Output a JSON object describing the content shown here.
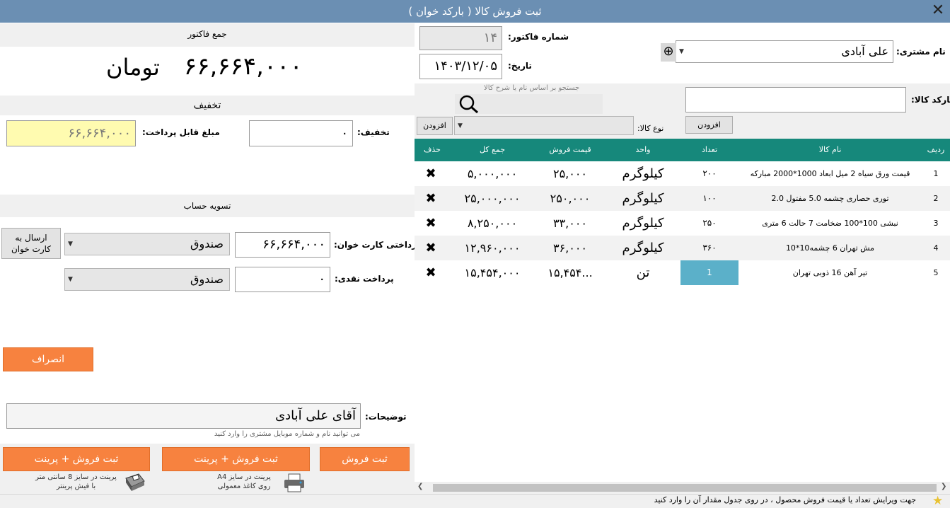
{
  "window": {
    "title": "ثبت فروش کالا ( بارکد خوان )",
    "close": "✕"
  },
  "invoice": {
    "total_heading": "جمع فاکتور",
    "total_amount": "۶۶,۶۶۴,۰۰۰",
    "currency": "تومان",
    "discount_heading": "تخفیف",
    "discount_label": "تخفیف:",
    "discount_value": "۰",
    "payable_label": "مبلغ قابل پرداخت:",
    "payable_value": "۶۶,۶۶۴,۰۰۰",
    "settlement_heading": "تسویه حساب",
    "card_payment_label": "پرداختی کارت خوان:",
    "card_payment_value": "۶۶,۶۶۴,۰۰۰",
    "card_account": "صندوق",
    "send_to_pos": "ارسال به\nکارت خوان",
    "cash_payment_label": "پرداخت نقدی:",
    "cash_payment_value": "۰",
    "cash_account": "صندوق",
    "cancel_button": "انصراف",
    "notes_label": "توضیحات:",
    "notes_value": "آقای علی آبادی",
    "notes_hint": "می توانید نام و شماره موبایل مشتری را وارد کنید",
    "save_button": "ثبت فروش",
    "save_print_a4_button": "ثبت فروش + پرینت",
    "save_print_a4_hint": "پرینت در سایز A4\nروی کاغذ معمولی",
    "save_print_8cm_button": "ثبت فروش + پرینت",
    "save_print_8cm_hint": "پرینت در سایز 8 سانتی متر\nبا فیش پرینتر"
  },
  "header": {
    "invoice_number_label": "شماره فاکتور:",
    "invoice_number": "۱۴",
    "date_label": "تاریخ:",
    "date": "۱۴۰۳/۱۲/۰۵",
    "customer_label": "نام مشتری:",
    "customer": "علی آبادی",
    "barcode_label": "بارکد کالا:",
    "barcode_value": "",
    "add_button": "افزودن",
    "search_hint": "جستجو بر اساس نام یا شرح کالا",
    "product_type_label": "نوع کالا:",
    "product_type_add_button": "افزودن"
  },
  "table": {
    "columns": [
      "ردیف",
      "نام کالا",
      "تعداد",
      "واحد",
      "قیمت فروش",
      "جمع کل",
      "حذف"
    ],
    "rows": [
      {
        "no": "1",
        "name": "قیمت ورق سیاه 2 میل ابعاد 1000*2000 مبارکه",
        "qty": "۲۰۰",
        "unit": "کیلوگرم",
        "price": "۲۵,۰۰۰",
        "total": "۵,۰۰۰,۰۰۰"
      },
      {
        "no": "2",
        "name": "توری حصاری چشمه 5.0 مفتول 2.0",
        "qty": "۱۰۰",
        "unit": "کیلوگرم",
        "price": "۲۵۰,۰۰۰",
        "total": "۲۵,۰۰۰,۰۰۰"
      },
      {
        "no": "3",
        "name": "نبشی 100*100 ضخامت 7 حالت 6 متری",
        "qty": "۲۵۰",
        "unit": "کیلوگرم",
        "price": "۳۳,۰۰۰",
        "total": "۸,۲۵۰,۰۰۰"
      },
      {
        "no": "4",
        "name": "مش تهران 6  چشمه10*10",
        "qty": "۳۶۰",
        "unit": "کیلوگرم",
        "price": "۳۶,۰۰۰",
        "total": "۱۲,۹۶۰,۰۰۰"
      },
      {
        "no": "5",
        "name": "تیر آهن 16 ذوبی تهران",
        "qty": "1",
        "unit": "تن",
        "price": "۱۵,۴۵۴...",
        "total": "۱۵,۴۵۴,۰۰۰"
      }
    ]
  },
  "status": {
    "hint": "جهت ویرایش تعداد یا قیمت فروش محصول ، در روی جدول مقدار آن را وارد کنید"
  },
  "icons": {
    "delete": "✖",
    "search": "search-icon",
    "add": "⊕",
    "star": "★"
  },
  "colors": {
    "title_bar": "#6b8fb3",
    "table_header": "#16887b",
    "accent_button": "#f7823f",
    "payable_bg": "#fffbb0",
    "qty_edit": "#5bb0c9"
  }
}
